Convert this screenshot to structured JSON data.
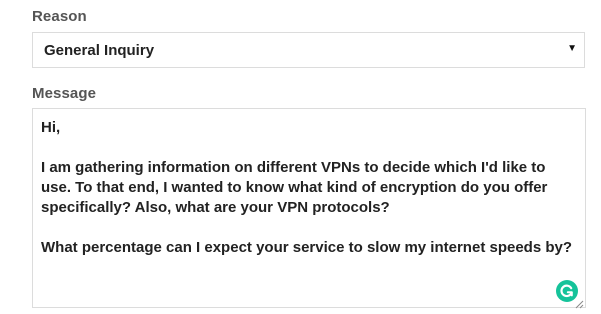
{
  "reason": {
    "label": "Reason",
    "selected_value": "General Inquiry",
    "arrow_icon": "dropdown-triangle-icon"
  },
  "message": {
    "label": "Message",
    "value": "Hi,\n\nI am gathering information on different VPNs to decide which I'd like to use. To that end, I wanted to know what kind of encryption do you offer specifically? Also, what are your VPN protocols?\n\nWhat percentage can I expect your service to slow my internet speeds by?",
    "resize_icon": "resize-handle-icon",
    "assistant_icon": "grammarly-icon"
  },
  "colors": {
    "label_text": "#555555",
    "value_text": "#222222",
    "border": "#dcdcdc",
    "grammarly_green": "#15c39a"
  }
}
